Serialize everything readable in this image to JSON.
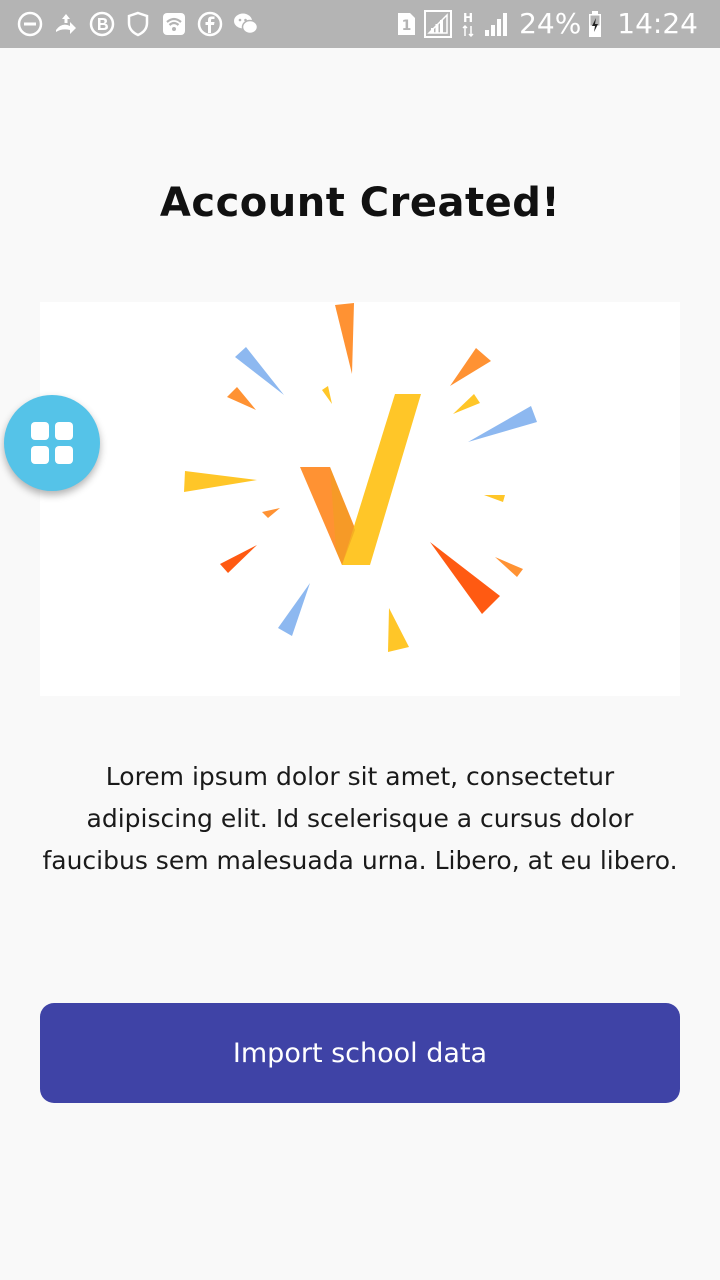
{
  "status_bar": {
    "battery_percent": "24%",
    "time": "14:24",
    "sim_slot": "1",
    "network_type": "H",
    "left_icons": [
      "dnd-icon",
      "data-transfer-icon",
      "b-icon",
      "shield-icon",
      "wifi-icon",
      "facebook-icon",
      "wechat-icon"
    ],
    "right_icons": [
      "sim-icon",
      "signal-icon-1",
      "network-type-icon",
      "signal-icon-2",
      "battery-icon"
    ]
  },
  "main": {
    "title": "Account Created!",
    "description": "Lorem ipsum dolor sit amet, consectetur adipiscing elit. Id scelerisque a cursus dolor faucibus sem malesuada urna. Libero, at eu libero.",
    "primary_button_label": "Import school data"
  },
  "floating_button": {
    "icon": "grid-icon"
  },
  "colors": {
    "status_bar": "#b4b4b4",
    "background": "#f9f9f9",
    "button": "#3f43a6",
    "fab": "#55c3e8",
    "check_orange": "#ff9233",
    "check_yellow": "#ffc628",
    "burst_blue": "#8db8f0",
    "burst_red": "#ff5a12"
  }
}
